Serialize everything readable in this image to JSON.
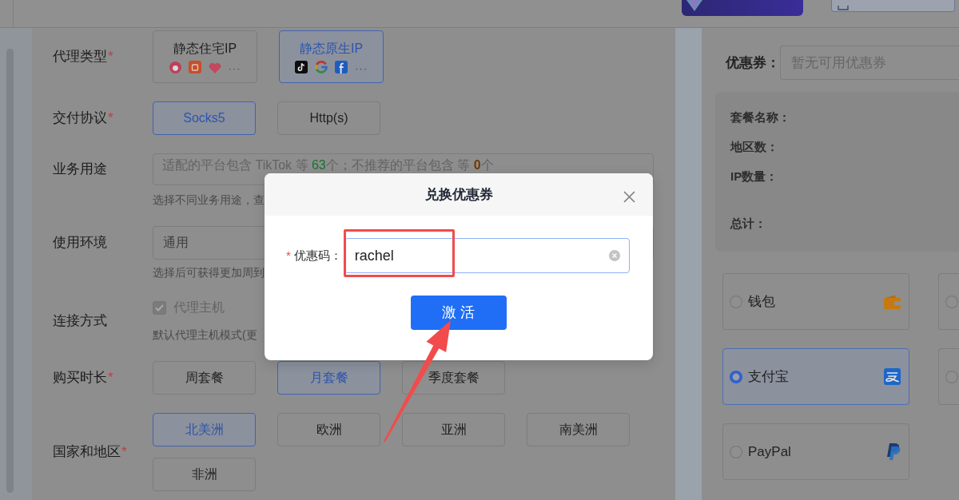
{
  "form": {
    "rows": [
      {
        "kind": "cards",
        "label": "代理类型",
        "required_mark": "*",
        "options": [
          {
            "label": "静态住宅IP",
            "more": "···",
            "selected": false
          },
          {
            "label": "静态原生IP",
            "more": "···",
            "selected": true
          }
        ]
      },
      {
        "kind": "choices",
        "label": "交付协议",
        "required_mark": "*",
        "options": [
          {
            "label": "Socks5",
            "selected": true
          },
          {
            "label": "Http(s)",
            "selected": false
          }
        ]
      },
      {
        "kind": "input",
        "label": "业务用途",
        "placeholder_parts": [
          {
            "text": "适配的平台包含 TikTok 等 ",
            "kind": "plain"
          },
          {
            "text": "63",
            "kind": "good"
          },
          {
            "text": "个；不推荐的平台包含 等 ",
            "kind": "plain"
          },
          {
            "text": "0",
            "kind": "warn"
          },
          {
            "text": "个",
            "kind": "plain"
          }
        ],
        "hint": "选择不同业务用途，查"
      },
      {
        "kind": "select",
        "label": "使用环境",
        "value": "通用",
        "hint": "选择后可获得更加周到"
      },
      {
        "kind": "checkbox",
        "label": "连接方式",
        "option": {
          "label": "代理主机",
          "checked": true,
          "disabled": true
        },
        "hint": "默认代理主机模式(更"
      },
      {
        "kind": "choices",
        "label": "购买时长",
        "required_mark": "*",
        "options": [
          {
            "label": "周套餐",
            "selected": false
          },
          {
            "label": "月套餐",
            "selected": true
          },
          {
            "label": "季度套餐",
            "selected": false
          }
        ]
      },
      {
        "kind": "choices",
        "label": "国家和地区",
        "required_mark": "*",
        "options": [
          {
            "label": "北美洲",
            "selected": true
          },
          {
            "label": "欧洲",
            "selected": false
          },
          {
            "label": "亚洲",
            "selected": false
          },
          {
            "label": "南美洲",
            "selected": false
          },
          {
            "label": "非洲",
            "selected": false
          }
        ]
      }
    ]
  },
  "order": {
    "coupon": {
      "label": "优惠券：",
      "placeholder": "暂无可用优惠券"
    },
    "summary": {
      "lines": [
        "套餐名称：",
        "地区数：",
        "IP数量："
      ],
      "total": "总计："
    },
    "payment_methods": [
      {
        "label": "钱包",
        "selected": false
      },
      {
        "selected": false
      },
      {
        "label": "支付宝",
        "selected": true
      },
      {
        "selected": false
      },
      {
        "label": "PayPal",
        "selected": false
      }
    ]
  },
  "dialog": {
    "title": "兑换优惠券",
    "field": {
      "required_mark": "*",
      "label": "优惠码：",
      "value": "rachel"
    },
    "submit": "激 活"
  }
}
